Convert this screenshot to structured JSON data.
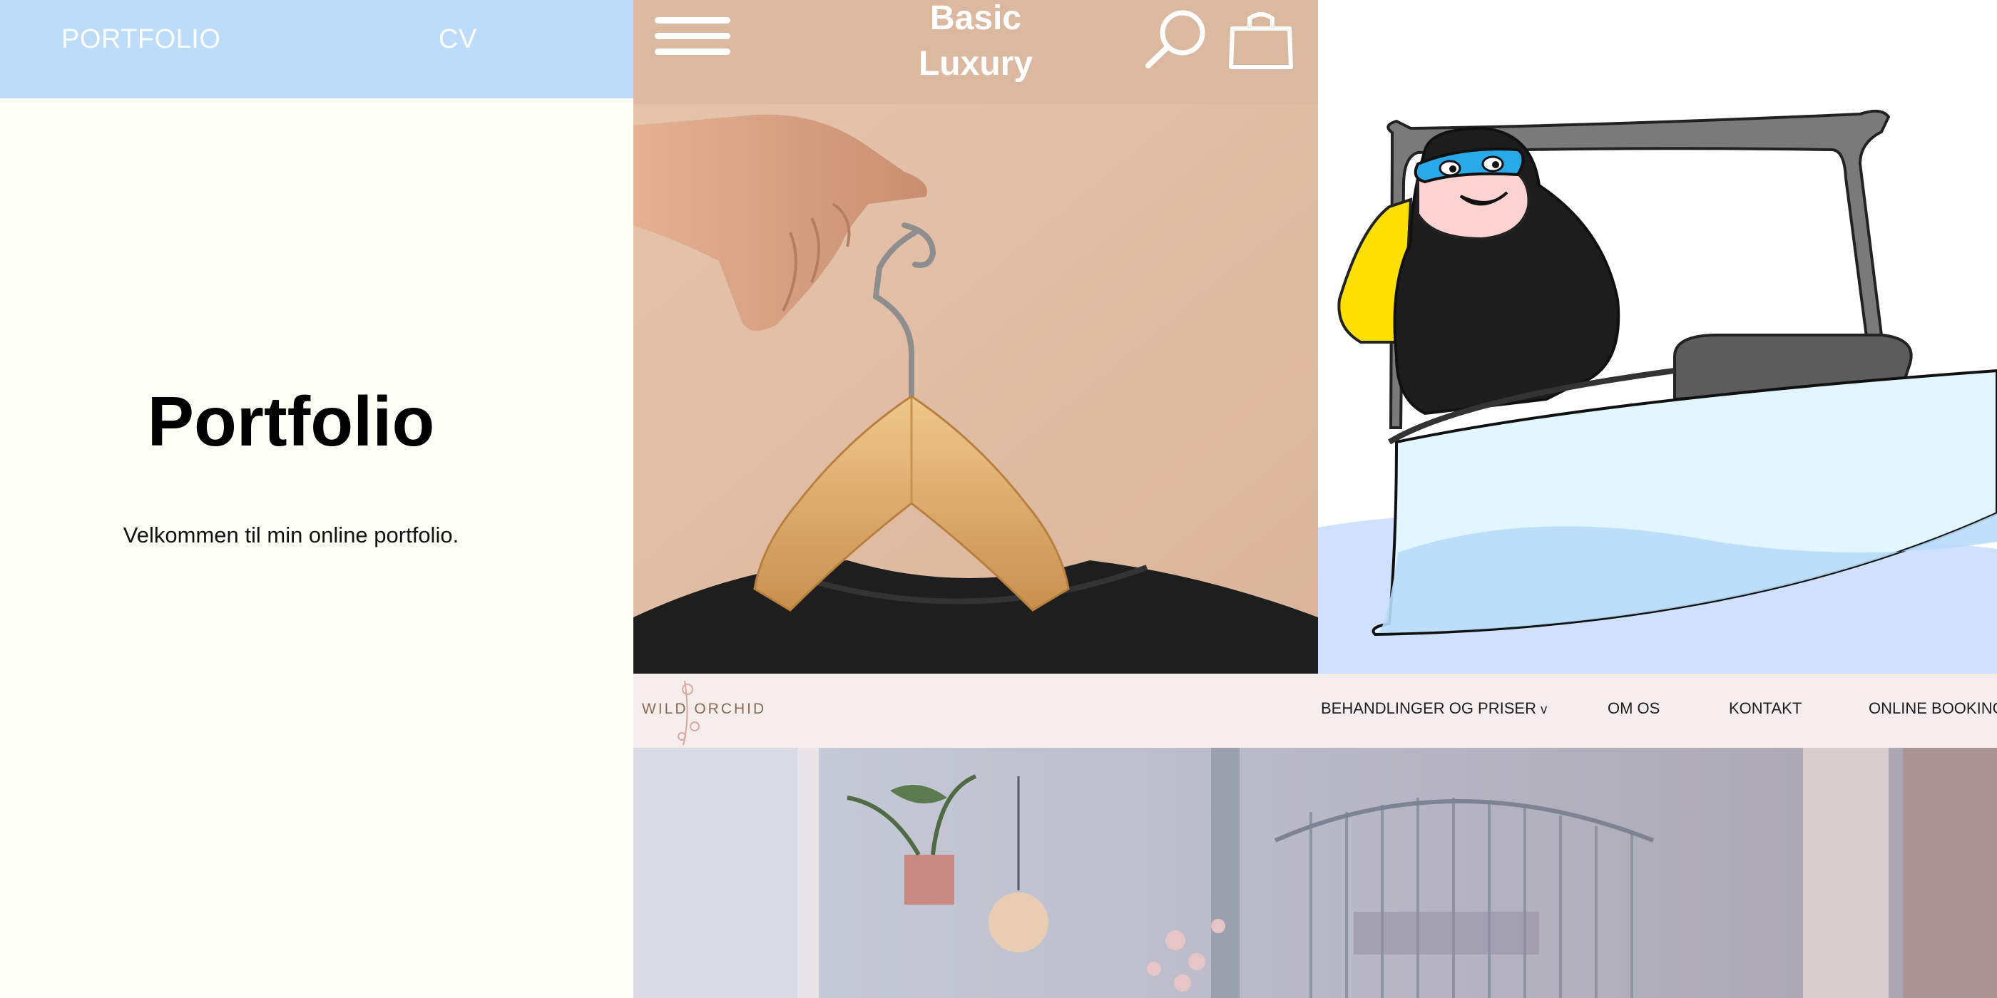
{
  "portfolio": {
    "nav": {
      "portfolio": "PORTFOLIO",
      "cv": "CV"
    },
    "title": "Portfolio",
    "subtitle": "Velkommen til min online portfolio."
  },
  "shop": {
    "brand_line1": "Basic",
    "brand_line2": "Luxury",
    "icons": [
      "hamburger-menu-icon",
      "search-icon",
      "shopping-bag-icon"
    ]
  },
  "salon": {
    "logo": "WILD ORCHID",
    "nav": {
      "treatments": "BEHANDLINGER OG PRISER",
      "treatments_caret": "v",
      "about": "OM OS",
      "contact": "KONTAKT",
      "booking": "ONLINE BOOKING"
    }
  },
  "colors": {
    "nav_blue": "#bcdcf9",
    "page_bg": "#fefff7",
    "shop_bg": "#dbb9a1",
    "salon_bg": "#f6eeec"
  }
}
